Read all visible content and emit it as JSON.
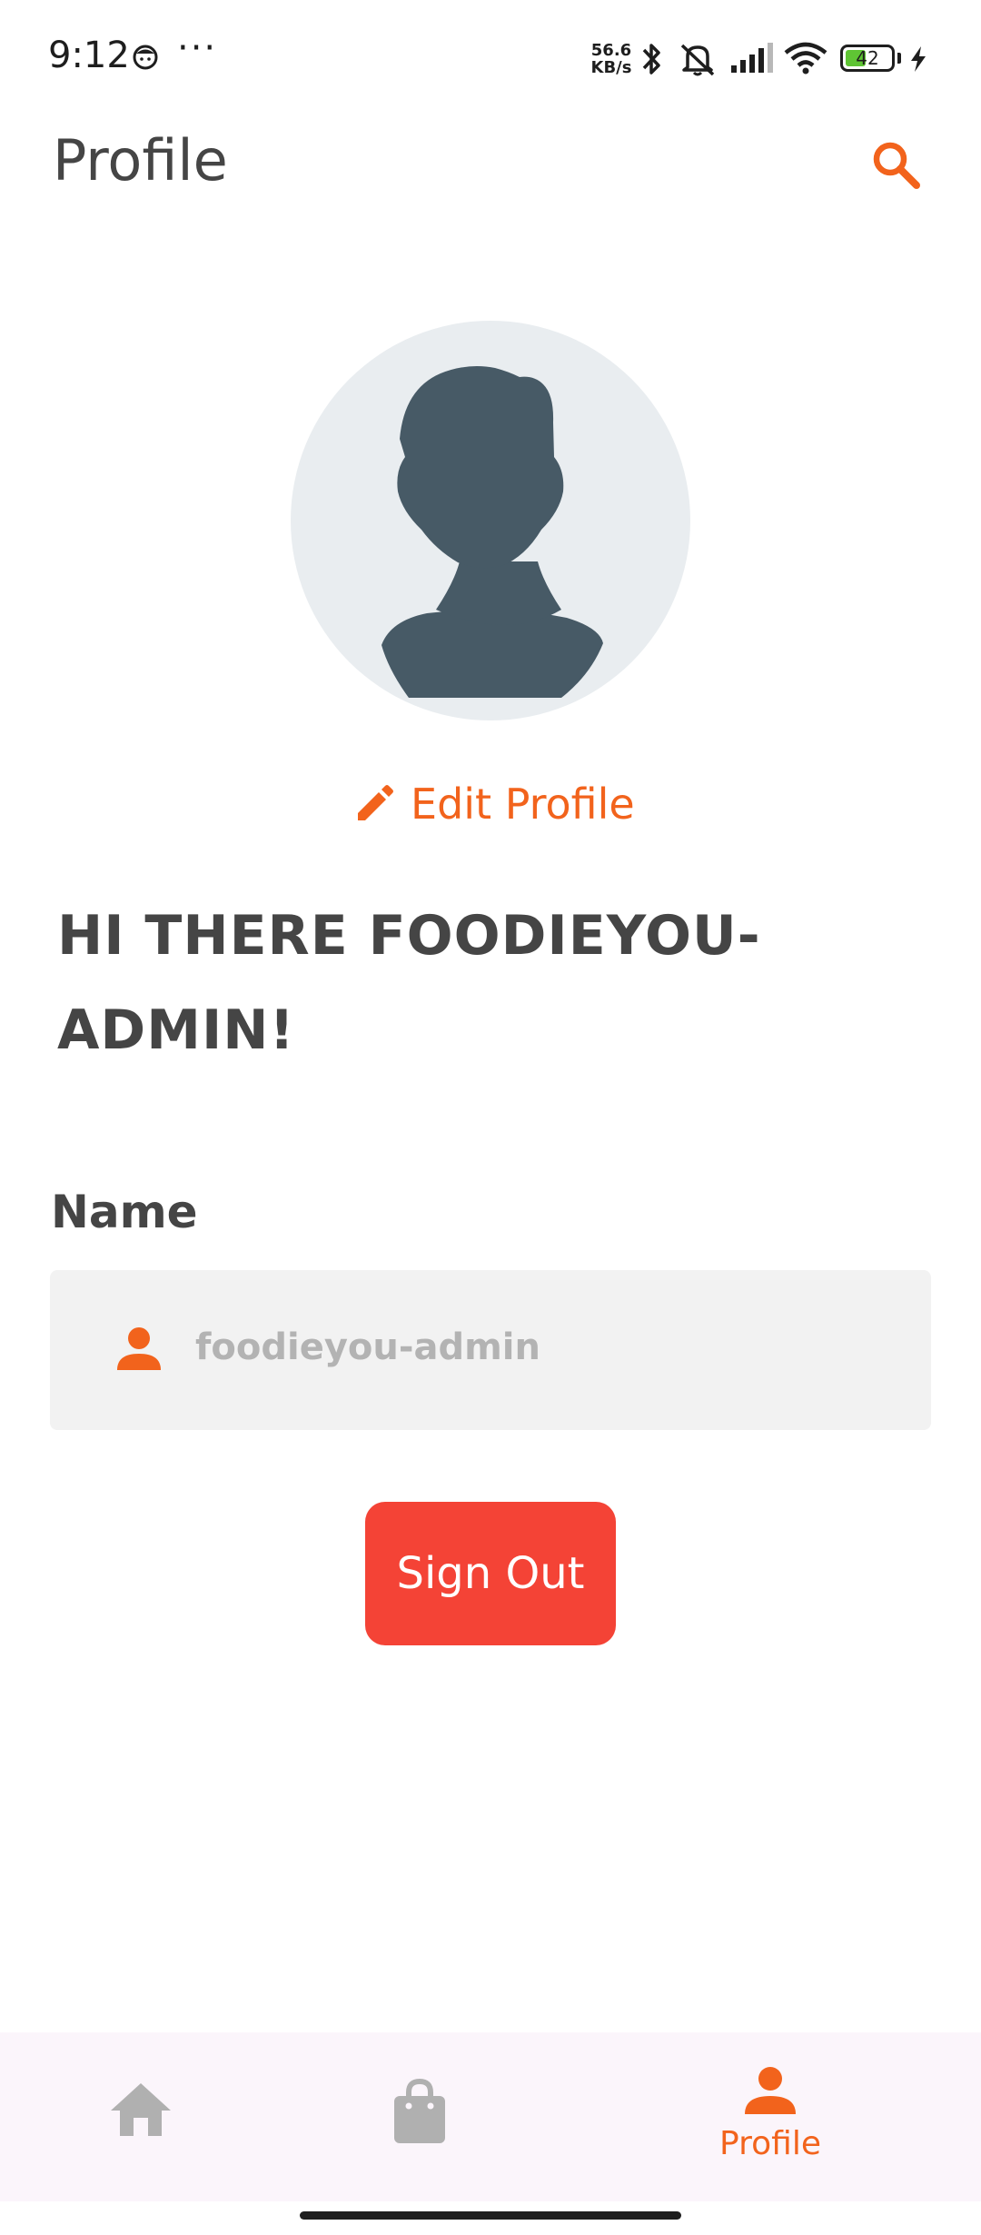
{
  "status_bar": {
    "time": "9:12",
    "more": "···",
    "net_speed_value": "56.6",
    "net_speed_unit": "KB/s",
    "battery_level": "42"
  },
  "app_bar": {
    "title": "Profile"
  },
  "profile": {
    "edit_label": "Edit Profile",
    "greeting": "HI THERE FOODIEYOU-ADMIN!",
    "name_label": "Name",
    "name_value": "foodieyou-admin",
    "sign_out_label": "Sign Out"
  },
  "bottom_nav": {
    "items": [
      {
        "icon": "home-icon",
        "label": ""
      },
      {
        "icon": "shopping-bag-icon",
        "label": ""
      },
      {
        "icon": "person-icon",
        "label": "Profile"
      }
    ]
  },
  "colors": {
    "accent": "#f2631c",
    "danger": "#f44336",
    "avatar_bg": "#e9edf0",
    "avatar_fg": "#475a66",
    "nav_bg": "#fbf5fb",
    "field_bg": "#f2f2f2"
  }
}
